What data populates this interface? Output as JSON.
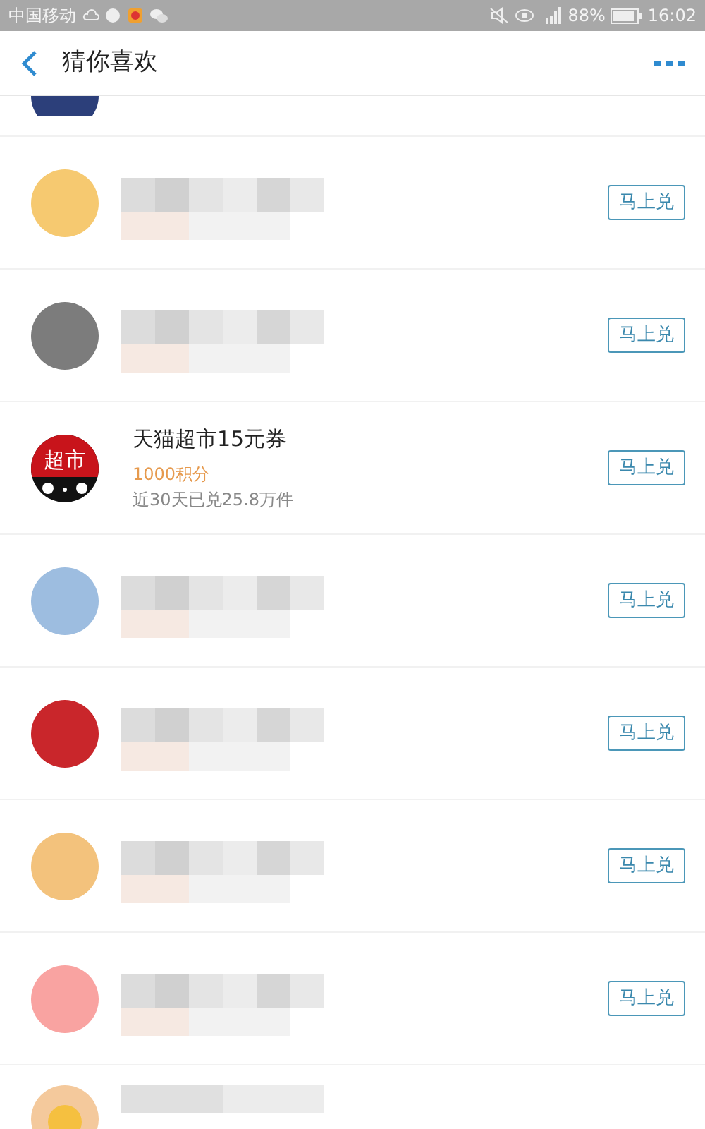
{
  "status_bar": {
    "carrier": "中国移动",
    "battery": "88%",
    "time": "16:02"
  },
  "header": {
    "title": "猜你喜欢"
  },
  "items": [
    {
      "kind": "cut_top",
      "color": "#2c3f7a"
    },
    {
      "kind": "obscured",
      "color": "#f6c970",
      "button": "马上兑"
    },
    {
      "kind": "obscured",
      "color": "#7c7c7c",
      "button": "马上兑"
    },
    {
      "kind": "product",
      "logo_text": "超市",
      "name": "天猫超市15元券",
      "points": "1000积分",
      "sales": "近30天已兑25.8万件",
      "button": "马上兑"
    },
    {
      "kind": "obscured",
      "color": "#9dbde0",
      "button": "马上兑"
    },
    {
      "kind": "obscured",
      "color": "#c9262b",
      "button": "马上兑"
    },
    {
      "kind": "obscured",
      "color": "#f3c27c",
      "button": "马上兑"
    },
    {
      "kind": "obscured",
      "color": "#f9a3a1",
      "button": "马上兑"
    },
    {
      "kind": "cut_bottom",
      "color": "#f4c99c"
    }
  ]
}
